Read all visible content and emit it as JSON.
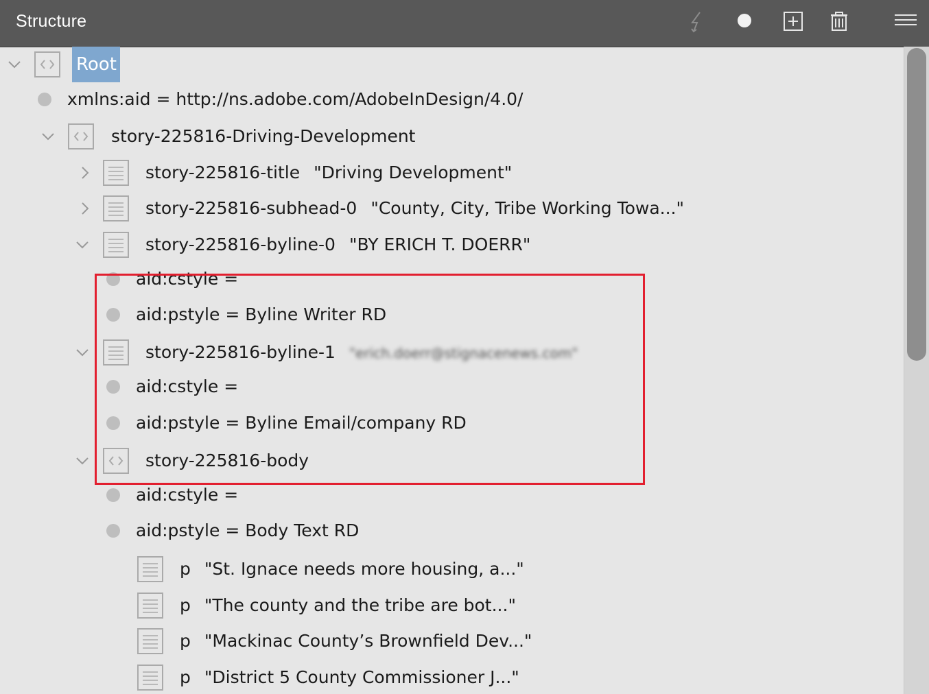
{
  "panel": {
    "title": "Structure",
    "toolbar": {
      "icons": [
        "lightning-icon",
        "record-dot-icon",
        "add-element-icon",
        "trash-icon",
        "menu-icon"
      ]
    }
  },
  "tree": {
    "root_label": "Root",
    "rows": [
      {
        "name": "xmlns:aid = http://ns.adobe.com/AdobeInDesign/4.0/"
      },
      {
        "name": "story-225816-Driving-Development"
      },
      {
        "name": "story-225816-title",
        "value": "\"Driving Development\""
      },
      {
        "name": "story-225816-subhead-0",
        "value": "\"County, City, Tribe Working Towa...\""
      },
      {
        "name": "story-225816-byline-0",
        "value": "\"BY ERICH T. DOERR\""
      },
      {
        "name": "aid:cstyle ="
      },
      {
        "name": "aid:pstyle = Byline Writer RD"
      },
      {
        "name": "story-225816-byline-1",
        "value": "\"erich.doerr@stignacenews.com\""
      },
      {
        "name": "aid:cstyle ="
      },
      {
        "name": "aid:pstyle = Byline Email/company RD"
      },
      {
        "name": "story-225816-body"
      },
      {
        "name": "aid:cstyle ="
      },
      {
        "name": "aid:pstyle = Body Text RD"
      },
      {
        "name": "p",
        "value": "\"St. Ignace needs more housing, a...\""
      },
      {
        "name": "p",
        "value": "\"The county and the tribe are bot...\""
      },
      {
        "name": "p",
        "value": "\"Mackinac County’s Brownfield Dev...\""
      },
      {
        "name": "p",
        "value": "\"District 5 County Commissioner J...\""
      }
    ]
  },
  "colors": {
    "header_bg": "#585858",
    "tree_bg": "#e6e6e6",
    "root_highlight": "#7fa7cf",
    "annotation_box": "#e21f2f"
  }
}
